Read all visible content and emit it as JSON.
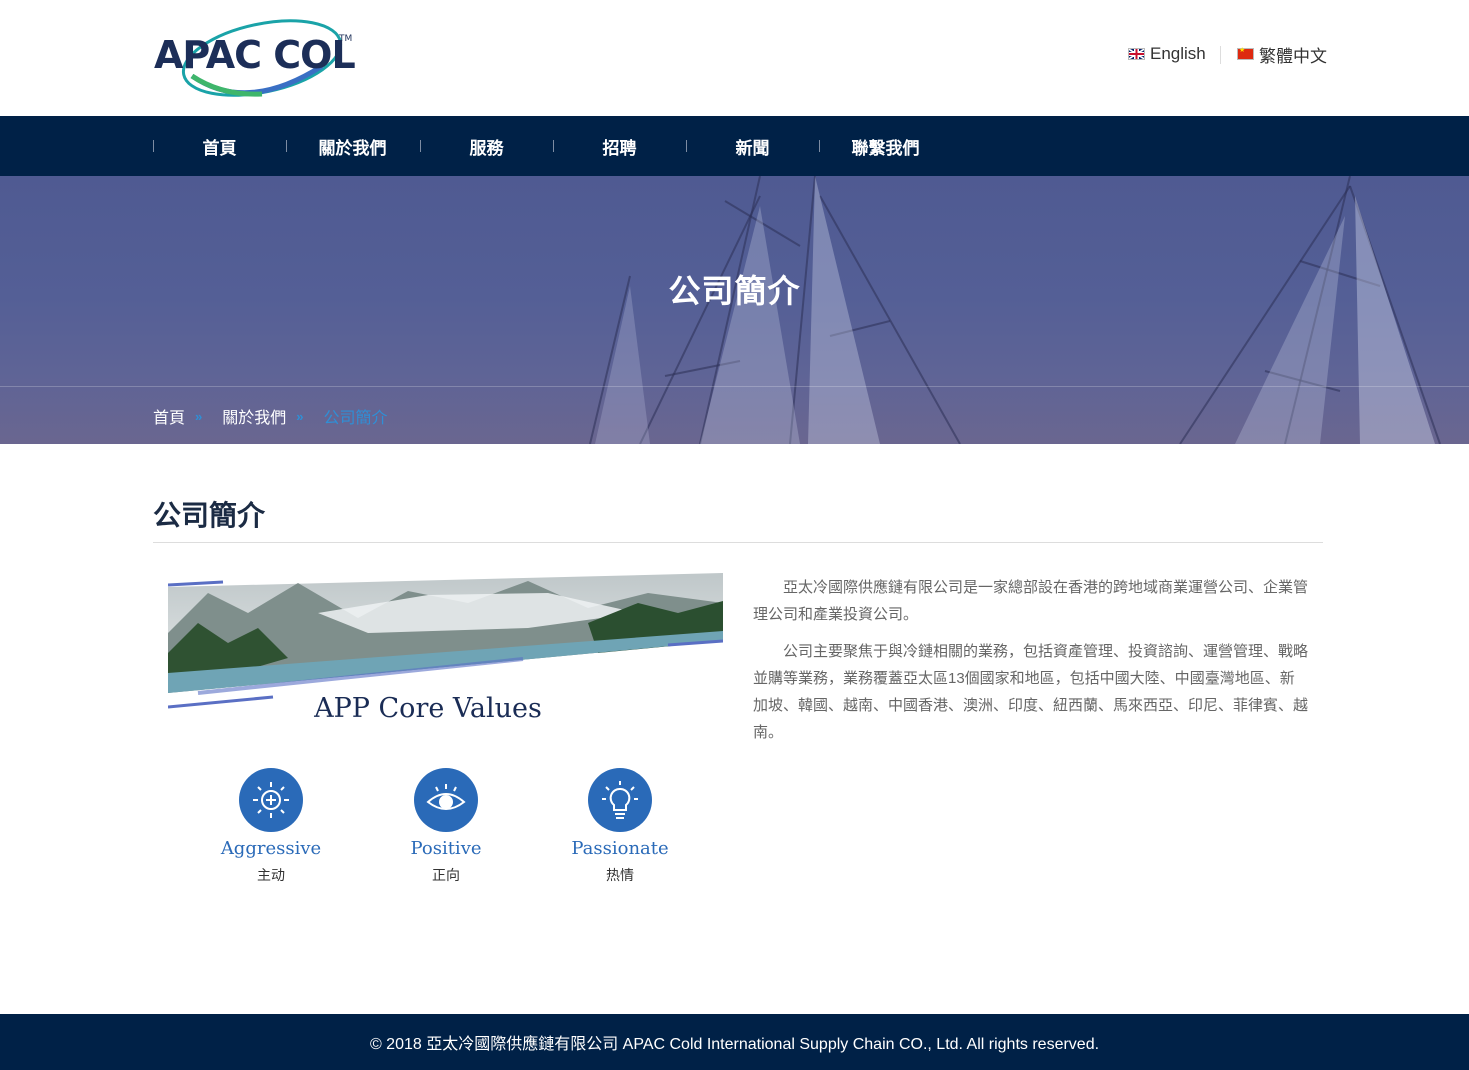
{
  "header": {
    "logo_text": "APAC COLD",
    "logo_tm": "TM",
    "languages": [
      {
        "label": "English",
        "flag": "uk-flag-icon"
      },
      {
        "label": "繁體中文",
        "flag": "china-flag-icon"
      }
    ]
  },
  "nav": {
    "items": [
      {
        "label": "首頁"
      },
      {
        "label": "關於我們"
      },
      {
        "label": "服務"
      },
      {
        "label": "招聘"
      },
      {
        "label": "新聞"
      },
      {
        "label": "聯繫我們"
      }
    ]
  },
  "banner": {
    "title": "公司簡介",
    "breadcrumb": [
      {
        "label": "首頁"
      },
      {
        "label": "關於我們"
      },
      {
        "label": "公司簡介"
      }
    ],
    "separator": "»"
  },
  "main": {
    "heading": "公司簡介",
    "core_values": {
      "title": "APP Core Values",
      "items": [
        {
          "en": "Aggressive",
          "cn": "主动",
          "icon": "sun-plus-icon"
        },
        {
          "en": "Positive",
          "cn": "正向",
          "icon": "eye-icon"
        },
        {
          "en": "Passionate",
          "cn": "热情",
          "icon": "lightbulb-icon"
        }
      ]
    },
    "paragraphs": [
      "亞太冷國際供應鏈有限公司是一家總部設在香港的跨地域商業運營公司、企業管理公司和產業投資公司。",
      "公司主要聚焦于與冷鏈相關的業務，包括資產管理、投資諮詢、運營管理、戰略並購等業務，業務覆蓋亞太區13個國家和地區，包括中國大陸、中國臺灣地區、新加坡、韓國、越南、中國香港、澳洲、印度、紐西蘭、馬來西亞、印尼、菲律賓、越南。"
    ]
  },
  "footer": {
    "copyright": "© 2018 亞太冷國際供應鏈有限公司 APAC Cold International Supply Chain CO., Ltd. All rights reserved."
  },
  "colors": {
    "navy": "#002147",
    "accent_blue": "#2a6ab8",
    "breadcrumb_active": "#2f8fd6"
  }
}
